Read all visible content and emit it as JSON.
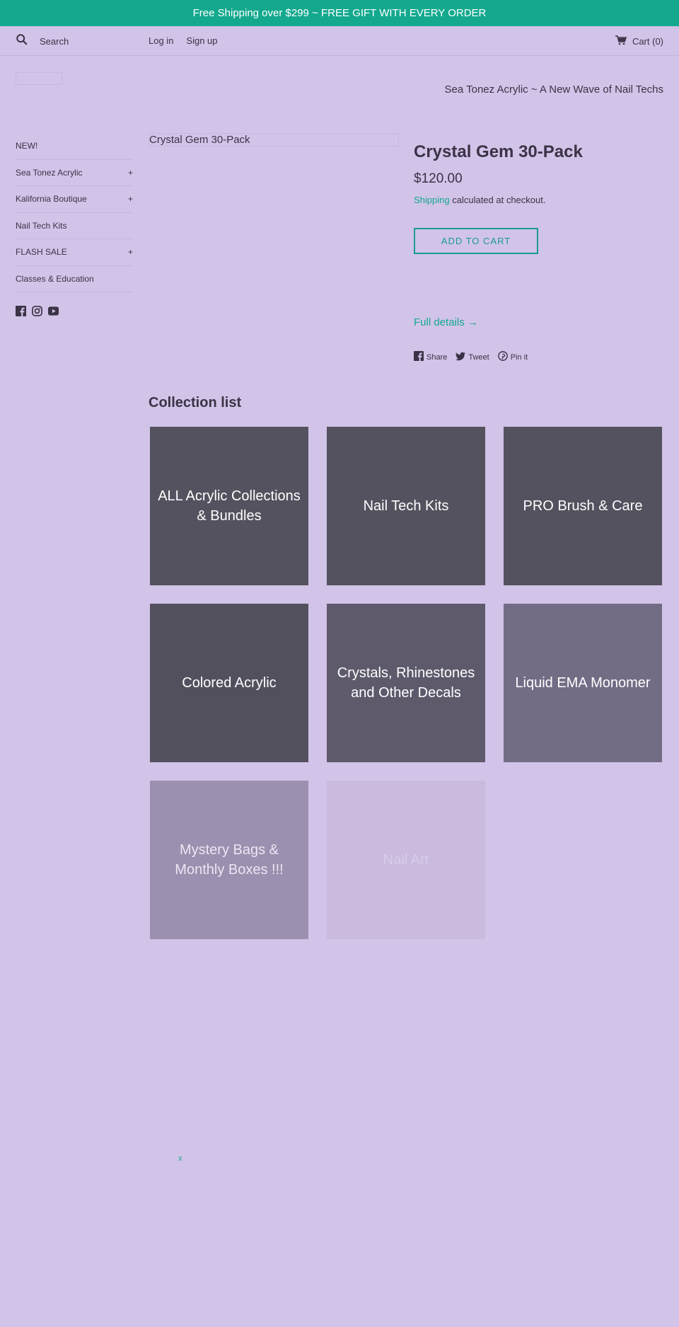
{
  "announcement": "Free Shipping over $299 ~ FREE GIFT WITH EVERY ORDER",
  "header": {
    "search_placeholder": "Search",
    "login": "Log in",
    "signup": "Sign up",
    "cart": "Cart (0)",
    "tagline": "Sea Tonez Acrylic ~ A New Wave of Nail Techs"
  },
  "sidebar": {
    "items": [
      {
        "label": "NEW!",
        "expand": ""
      },
      {
        "label": "Sea Tonez Acrylic",
        "expand": "+"
      },
      {
        "label": "Kalifornia Boutique",
        "expand": "+"
      },
      {
        "label": "Nail Tech Kits",
        "expand": ""
      },
      {
        "label": "FLASH SALE",
        "expand": "+"
      },
      {
        "label": "Classes & Education",
        "expand": ""
      }
    ],
    "social_icons": [
      "facebook-icon",
      "instagram-icon",
      "youtube-icon"
    ]
  },
  "product": {
    "image_alt": "Crystal Gem 30-Pack",
    "title": "Crystal Gem 30-Pack",
    "price": "$120.00",
    "shipping_link": "Shipping",
    "shipping_rest": " calculated at checkout.",
    "add_to_cart": "ADD TO CART",
    "full_details": "Full details →",
    "share": {
      "facebook": "Share",
      "twitter": "Tweet",
      "pinterest": "Pin it"
    }
  },
  "collection": {
    "heading": "Collection list",
    "tiles": [
      {
        "label": "ALL Acrylic Collections & Bundles",
        "color": "#53525e"
      },
      {
        "label": "Nail Tech Kits",
        "color": "#53525e"
      },
      {
        "label": "PRO Brush & Care",
        "color": "#53525e"
      },
      {
        "label": "Colored Acrylic",
        "color": "#53505e"
      },
      {
        "label": "Crystals, Rhinestones and Other Decals",
        "color": "#5e5a6c"
      },
      {
        "label": "Liquid EMA Monomer",
        "color": "#736c85"
      },
      {
        "label": "Mystery Bags & Monthly Boxes !!!",
        "color": "#9b90af"
      },
      {
        "label": "Nail Art",
        "color": "#cabade"
      }
    ]
  },
  "close_mark": "x",
  "colors": {
    "accent": "#14a98e",
    "background": "#d2c3e8",
    "button_border": "#1a9b93"
  }
}
